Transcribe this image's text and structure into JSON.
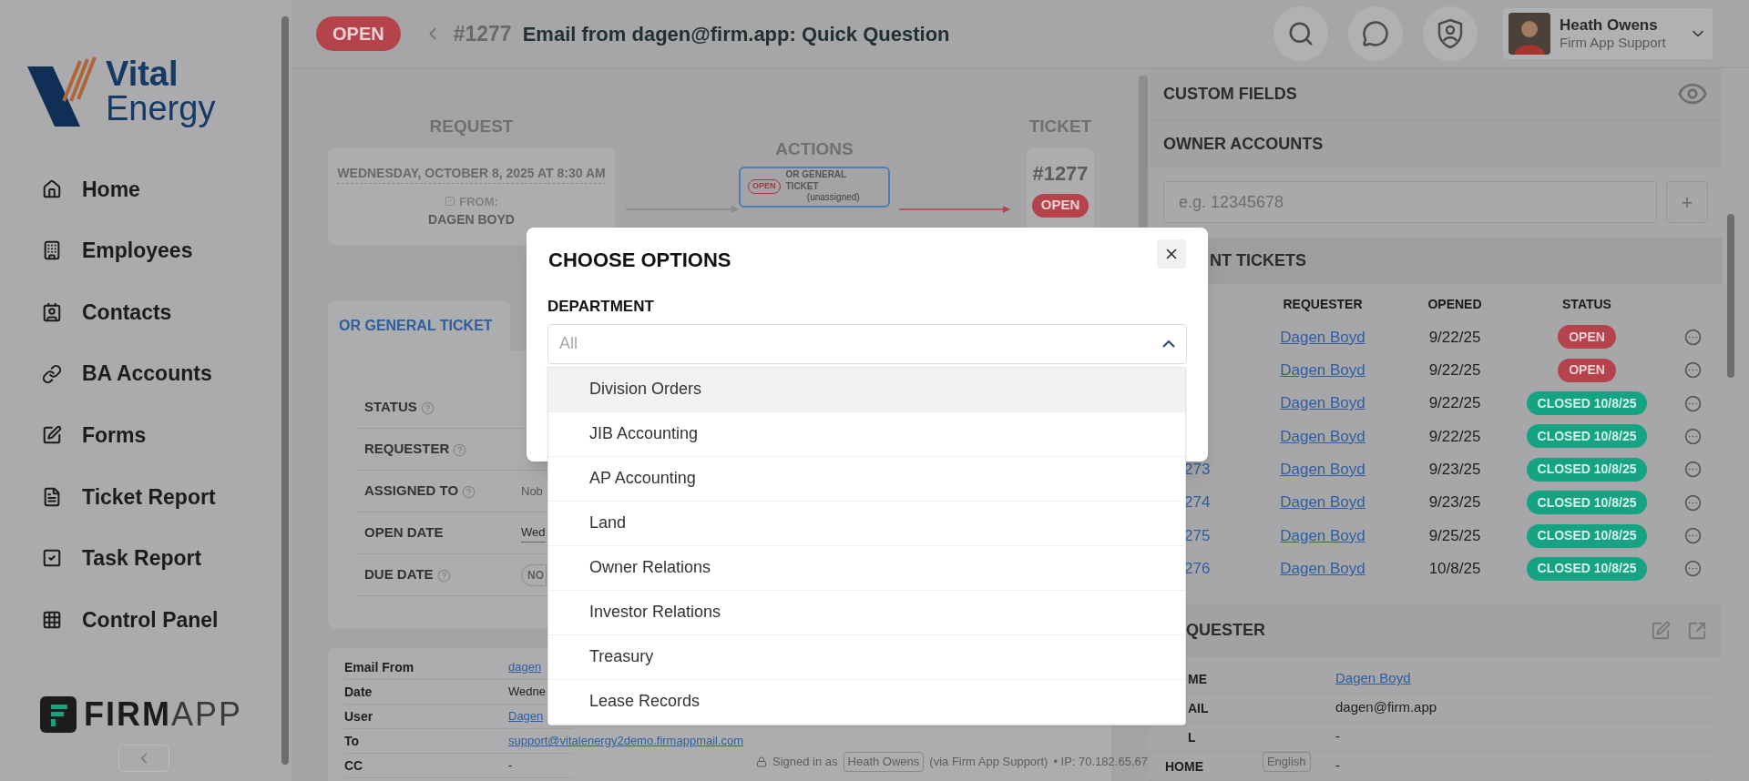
{
  "sidebar": {
    "logo": {
      "line1": "Vital",
      "line2": "Energy"
    },
    "items": [
      {
        "label": "Home"
      },
      {
        "label": "Employees"
      },
      {
        "label": "Contacts"
      },
      {
        "label": "BA Accounts"
      },
      {
        "label": "Forms"
      },
      {
        "label": "Ticket Report"
      },
      {
        "label": "Task Report"
      },
      {
        "label": "Control Panel"
      }
    ],
    "brand": {
      "bold": "FIRM",
      "light": "APP"
    }
  },
  "header": {
    "status": "OPEN",
    "number": "#1277",
    "title": "Email from dagen@firm.app: Quick Question",
    "user": {
      "name": "Heath Owens",
      "role": "Firm App Support"
    }
  },
  "flow": {
    "request": {
      "heading": "REQUEST",
      "date": "WEDNESDAY, OCTOBER 8, 2025 AT 8:30 AM",
      "from_label": "FROM:",
      "from": "DAGEN BOYD"
    },
    "actions": {
      "heading": "ACTIONS",
      "badge": "OPEN",
      "title": "OR GENERAL TICKET",
      "subtitle": "(unassigned)"
    },
    "ticket": {
      "heading": "TICKET",
      "number": "#1277",
      "status": "OPEN"
    }
  },
  "tabs": [
    {
      "label": "OR GENERAL TICKET",
      "selected": true
    }
  ],
  "fields": [
    {
      "label": "STATUS",
      "help": true
    },
    {
      "label": "REQUESTER",
      "help": true
    },
    {
      "label": "ASSIGNED TO",
      "help": true,
      "value": "Nob",
      "kind": "text"
    },
    {
      "label": "OPEN DATE",
      "help": false,
      "value": "Wed",
      "kind": "date"
    },
    {
      "label": "DUE DATE",
      "help": true,
      "value": "NO",
      "kind": "pill"
    }
  ],
  "email": [
    {
      "label": "Email From",
      "value": "dagen",
      "link": true
    },
    {
      "label": "Date",
      "value": "Wedne",
      "link": false
    },
    {
      "label": "User",
      "value": "Dagen",
      "link": true
    },
    {
      "label": "To",
      "value": "support@vitalenergy2demo.firmappmail.com",
      "link": true
    },
    {
      "label": "CC",
      "value": "-",
      "link": false
    }
  ],
  "right": {
    "custom_fields": "CUSTOM FIELDS",
    "owner_accounts": "OWNER ACCOUNTS",
    "owner_input": {
      "placeholder": "e.g. 12345678"
    },
    "add": "+",
    "recent": {
      "title": "NT TICKETS",
      "columns": [
        "REQUESTER",
        "OPENED",
        "STATUS"
      ],
      "rows": [
        {
          "requester": "Dagen Boyd",
          "opened": "9/22/25",
          "status": "OPEN",
          "kind": "open"
        },
        {
          "requester": "Dagen Boyd",
          "opened": "9/22/25",
          "status": "OPEN",
          "kind": "open"
        },
        {
          "requester": "Dagen Boyd",
          "opened": "9/22/25",
          "status": "CLOSED 10/8/25",
          "kind": "closed"
        },
        {
          "requester": "Dagen Boyd",
          "opened": "9/22/25",
          "status": "CLOSED 10/8/25",
          "kind": "closed"
        },
        {
          "number": "273",
          "requester": "Dagen Boyd",
          "opened": "9/23/25",
          "status": "CLOSED 10/8/25",
          "kind": "closed"
        },
        {
          "number": "274",
          "requester": "Dagen Boyd",
          "opened": "9/23/25",
          "status": "CLOSED 10/8/25",
          "kind": "closed"
        },
        {
          "number": "275",
          "requester": "Dagen Boyd",
          "opened": "9/25/25",
          "status": "CLOSED 10/8/25",
          "kind": "closed"
        },
        {
          "number": "276",
          "requester": "Dagen Boyd",
          "opened": "10/8/25",
          "status": "CLOSED 10/8/25",
          "kind": "closed"
        }
      ]
    },
    "requester": {
      "title": "QUESTER",
      "rows": [
        {
          "label": "ME",
          "value": "Dagen Boyd",
          "link": true
        },
        {
          "label": "AIL",
          "value": "dagen@firm.app",
          "link": false
        },
        {
          "label": "L",
          "value": "-",
          "link": false
        },
        {
          "label": "HOME",
          "value": "-",
          "link": false
        }
      ]
    }
  },
  "footer": {
    "signed_in": "Signed in as",
    "user": "Heath Owens",
    "via": "(via Firm App Support)",
    "ip": "• IP: 70.182.65.67",
    "language": "English"
  },
  "modal": {
    "title": "CHOOSE OPTIONS",
    "field_label": "DEPARTMENT",
    "placeholder": "All",
    "expanded": true,
    "options": [
      {
        "label": "Division Orders",
        "highlighted": true
      },
      {
        "label": "JIB Accounting",
        "highlighted": false
      },
      {
        "label": "AP Accounting",
        "highlighted": false
      },
      {
        "label": "Land",
        "highlighted": false
      },
      {
        "label": "Owner Relations",
        "highlighted": false
      },
      {
        "label": "Investor Relations",
        "highlighted": false
      },
      {
        "label": "Treasury",
        "highlighted": false
      },
      {
        "label": "Lease Records",
        "highlighted": false
      }
    ]
  }
}
